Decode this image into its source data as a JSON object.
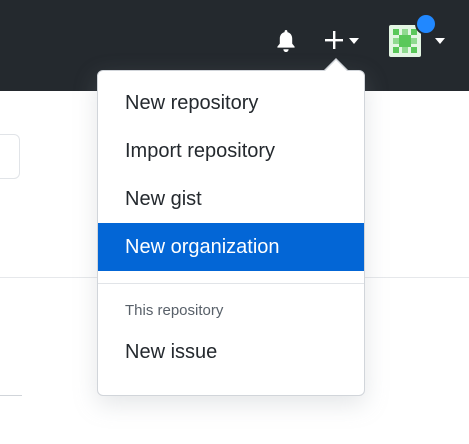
{
  "header": {
    "notifications_icon": "bell-icon",
    "create_icon": "plus-icon",
    "profile_icon": "avatar",
    "background": "#24292e",
    "unread_dot_color": "#2188ff"
  },
  "dropdown": {
    "items": [
      {
        "label": "New repository"
      },
      {
        "label": "Import repository"
      },
      {
        "label": "New gist"
      },
      {
        "label": "New organization",
        "active": true
      }
    ],
    "section_header": "This repository",
    "section_items": [
      {
        "label": "New issue"
      }
    ],
    "active_color": "#0366d6"
  }
}
